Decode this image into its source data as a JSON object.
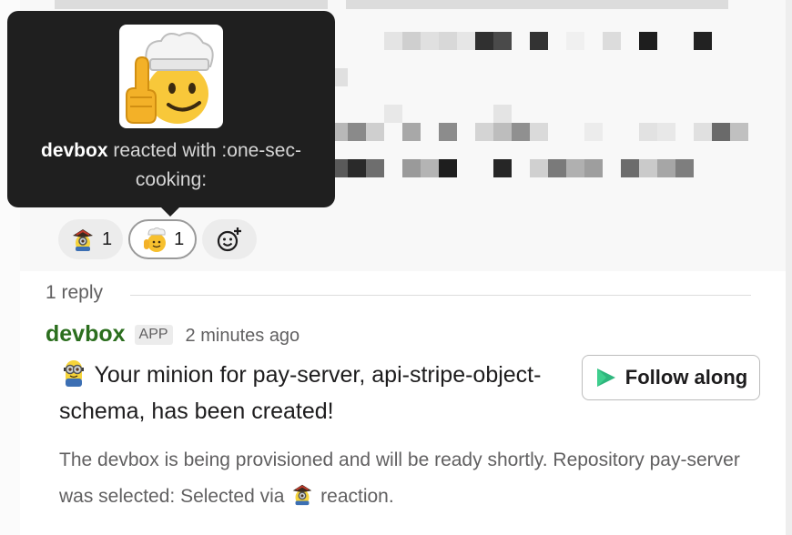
{
  "tooltip": {
    "user": "devbox",
    "reacted_text": "reacted with :one-sec-cooking:",
    "emoji_icon": "chef-thumb-emoji-icon"
  },
  "reactions": [
    {
      "emoji": "pirate-minion-emoji-icon",
      "count": "1",
      "selected": false
    },
    {
      "emoji": "chef-thumb-emoji-icon",
      "count": "1",
      "selected": true
    },
    {
      "emoji": "add-reaction-icon"
    }
  ],
  "thread": {
    "reply_count": "1 reply"
  },
  "message": {
    "author": "devbox",
    "badge": "APP",
    "timestamp": "2 minutes ago",
    "text": "Your minion for pay-server, api-stripe-object-schema, has been created!",
    "follow_button": "Follow along",
    "details_before": "The devbox is being provisioned and will be ready shortly. Repository pay-server was selected: Selected via",
    "details_after": "reaction."
  },
  "colors": {
    "author": "#2b6e1e",
    "tooltip_bg": "#1f1f1f",
    "follow_icon": "#2eb67d"
  }
}
